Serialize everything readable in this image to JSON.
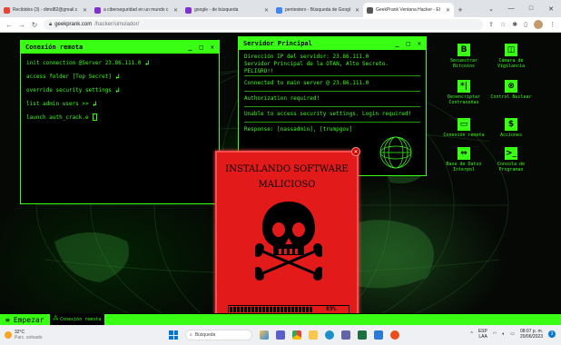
{
  "browser": {
    "tabs": [
      {
        "label": "Recibidos (3) - dimd82@gmail.c",
        "fav_color": "#ea4335"
      },
      {
        "label": "a ciberseguridad en un mundo c",
        "fav_color": "#8430ce"
      },
      {
        "label": "google - de búsqueda",
        "fav_color": "#8430ce"
      },
      {
        "label": "pentesters - Búsqueda de Googl",
        "fav_color": "#4285f4"
      },
      {
        "label": "GeekPrank Ventana Hacker - El",
        "fav_color": "#555555"
      }
    ],
    "url_domain": "geekprank.com",
    "url_path": "/hacker/simulador/",
    "window_controls": [
      "⌄",
      "—",
      "□",
      "✕"
    ]
  },
  "conexion_window": {
    "title": "Conexión remota",
    "lines": [
      {
        "text": "init connection @Server 23.86.111.0",
        "icon": "enter"
      },
      {
        "text": "access folder [Top Secret]",
        "icon": "enter"
      },
      {
        "text": "override security settings",
        "icon": "enter"
      },
      {
        "text": "list admin users >>",
        "icon": "enter"
      },
      {
        "text": "launch auth_crack.e",
        "icon": "cursor"
      }
    ]
  },
  "server_window": {
    "title": "Servidor Principal",
    "block1": [
      "Dirección IP del servidor: 23.86.111.0",
      "Servidor Principal de la OTAN, Alto Secreto. PELIGRO!!"
    ],
    "block2": [
      "Connected to main server @ 23.86.111.0"
    ],
    "block3": [
      "Authorization required!"
    ],
    "block4": [
      "Unable to access security settings. Login required!"
    ],
    "block5": [
      "Response: [nassadmin], [trumpgov]"
    ]
  },
  "desktop_icons": [
    {
      "label": "Secuestrar Bitcoins",
      "glyph": "B"
    },
    {
      "label": "Cámara de Vigilancia",
      "glyph": "◫"
    },
    {
      "label": "Desencriptar Contraseñas",
      "glyph": "*|"
    },
    {
      "label": "Control Nuclear",
      "glyph": "⊗"
    },
    {
      "label": "Conexión remota",
      "glyph": "▭"
    },
    {
      "label": "Acciones",
      "glyph": "$"
    },
    {
      "label": "Base de Datos Interpol",
      "glyph": "⇔"
    },
    {
      "label": "Consola de Programas",
      "glyph": ">_"
    }
  ],
  "popup": {
    "title_line1": "INSTALANDO SOFTWARE",
    "title_line2": "MALICIOSO",
    "progress_percent": 83,
    "progress_label": "83%"
  },
  "hacker_taskbar": {
    "start_label": "Empezar",
    "task_label": "Conexión remota"
  },
  "win_taskbar": {
    "temperature": "32°C",
    "weather": "Parc. soleado",
    "search_placeholder": "Búsqueda",
    "lang": "ESP",
    "lang_sub": "LAA",
    "time": "08:07 p. m.",
    "date": "20/06/2023",
    "notifications": "3"
  }
}
